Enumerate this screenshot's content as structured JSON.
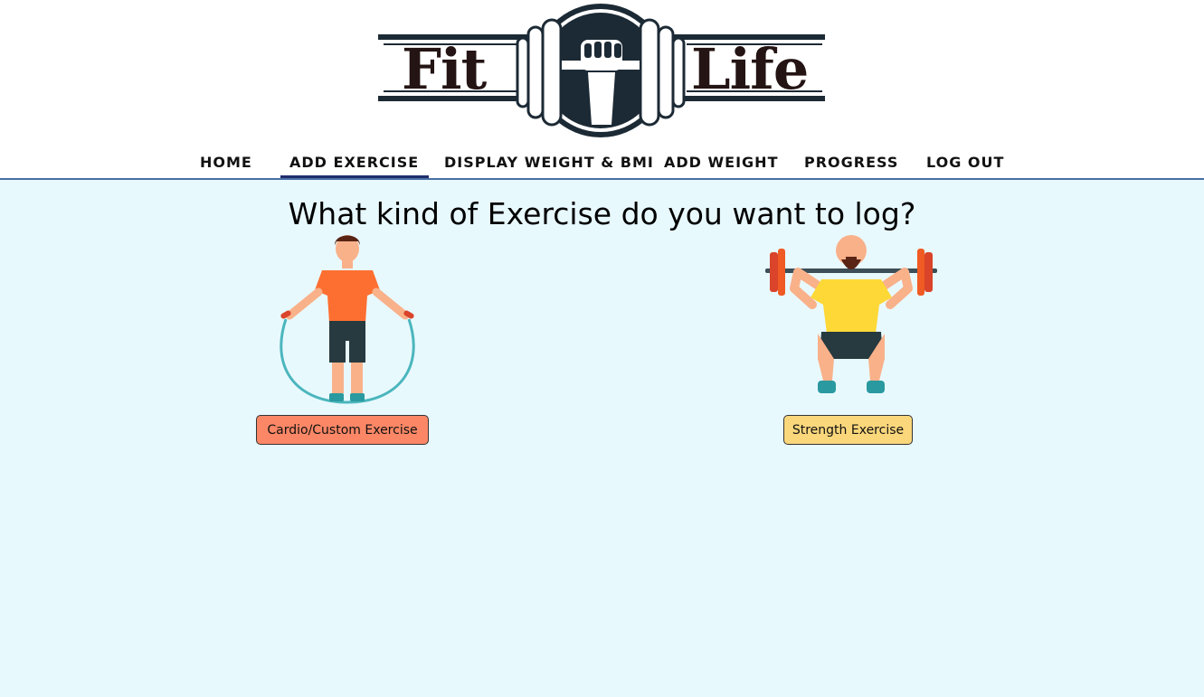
{
  "logo": {
    "word_left": "Fit",
    "word_right": "Life"
  },
  "nav": {
    "items": [
      {
        "label": "HOME"
      },
      {
        "label": "ADD EXERCISE",
        "active": true
      },
      {
        "label": "DISPLAY WEIGHT & BMI"
      },
      {
        "label": "ADD WEIGHT"
      },
      {
        "label": "PROGRESS"
      },
      {
        "label": "LOG OUT"
      }
    ]
  },
  "main": {
    "title": "What kind of Exercise do you want to log?",
    "options": [
      {
        "label": "Cardio/Custom Exercise",
        "icon": "jump-rope-figure-icon",
        "color": "#fb8766"
      },
      {
        "label": "Strength Exercise",
        "icon": "barbell-squat-figure-icon",
        "color": "#fbd77c"
      }
    ]
  },
  "colors": {
    "header_bg": "#ffffff",
    "main_bg": "#e8f9fe",
    "nav_active_underline": "#1f2d6b",
    "header_border": "#4a6fa5"
  }
}
